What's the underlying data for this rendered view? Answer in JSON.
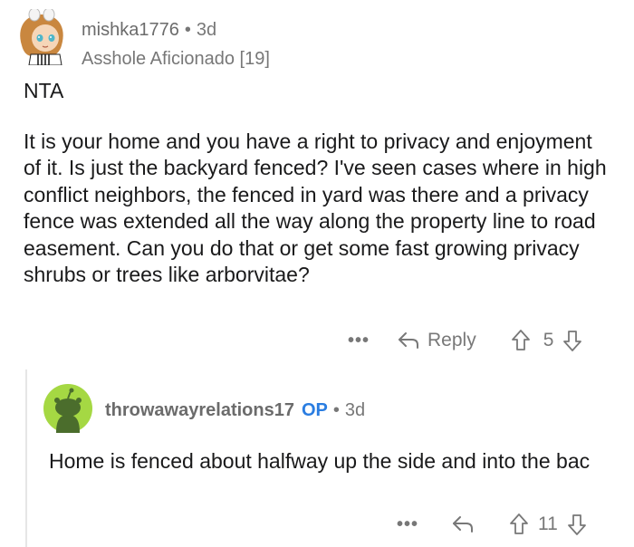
{
  "comment1": {
    "username": "mishka1776",
    "separator": "•",
    "time": "3d",
    "flair": "Asshole Aficionado [19]",
    "paragraphs": [
      "NTA",
      "It is your home and you have a right to privacy and enjoyment of it. Is just the backyard fenced? I've seen cases where in high conflict neighbors, the fenced in yard was there and a privacy fence was extended all the way along the property line to road easement. Can you do that or get some fast growing privacy shrubs or trees like arborvitae?"
    ],
    "more_label": "•••",
    "reply_label": "Reply",
    "score": "5"
  },
  "comment2": {
    "username": "throwawayrelations17",
    "op_badge": "OP",
    "separator": "•",
    "time": "3d",
    "body": "Home is fenced about halfway up the side and into the bac",
    "more_label": "•••",
    "score": "11"
  },
  "colors": {
    "op_badge": "#2a7de1",
    "avatar2_bg": "#a5d843",
    "meta_text": "#777777"
  }
}
